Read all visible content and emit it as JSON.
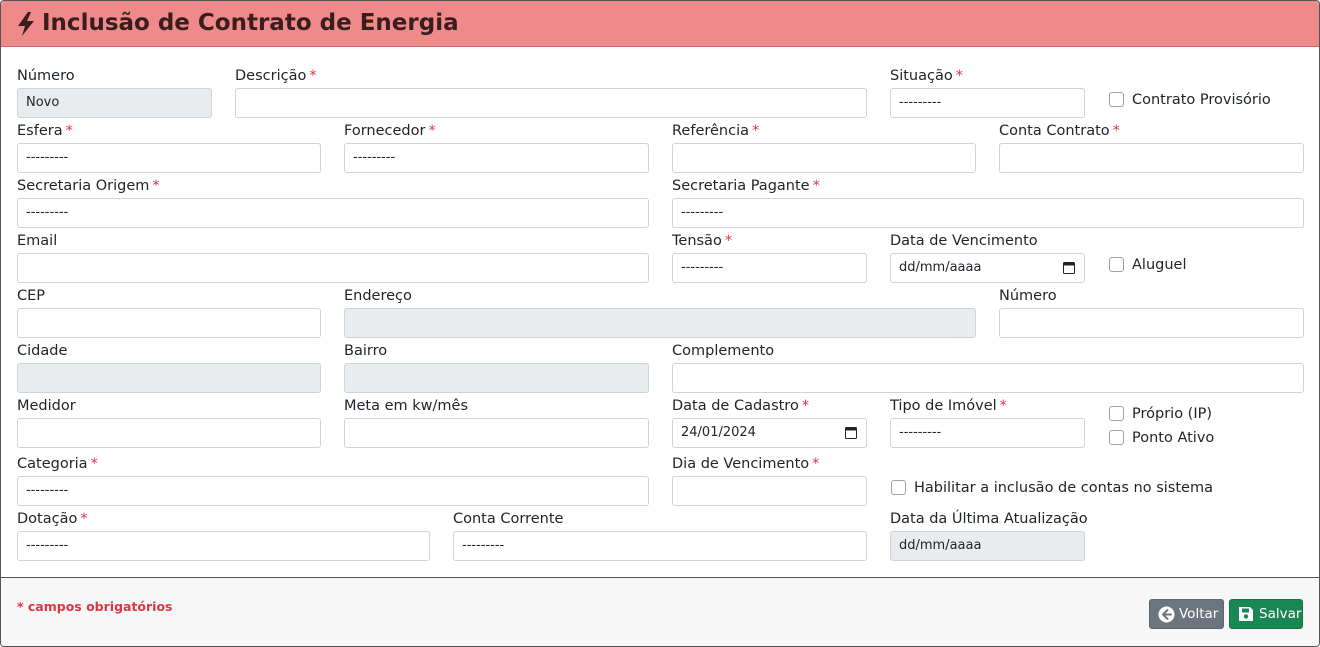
{
  "header": {
    "title": "Inclusão de Contrato de Energia"
  },
  "fields": {
    "numero": {
      "label": "Número",
      "value": "Novo"
    },
    "descricao": {
      "label": "Descrição",
      "value": ""
    },
    "situacao": {
      "label": "Situação",
      "value": "---------"
    },
    "contrato_provisorio": {
      "label": "Contrato Provisório",
      "checked": false
    },
    "esfera": {
      "label": "Esfera",
      "value": "---------"
    },
    "fornecedor": {
      "label": "Fornecedor",
      "value": "---------"
    },
    "referencia": {
      "label": "Referência",
      "value": ""
    },
    "conta_contrato": {
      "label": "Conta Contrato",
      "value": ""
    },
    "secretaria_origem": {
      "label": "Secretaria Origem",
      "value": "---------"
    },
    "secretaria_pagante": {
      "label": "Secretaria Pagante",
      "value": "---------"
    },
    "email": {
      "label": "Email",
      "value": ""
    },
    "tensao": {
      "label": "Tensão",
      "value": "---------"
    },
    "data_vencimento": {
      "label": "Data de Vencimento",
      "placeholder": "dd/mm/aaaa"
    },
    "aluguel": {
      "label": "Aluguel",
      "checked": false
    },
    "cep": {
      "label": "CEP",
      "value": ""
    },
    "endereco": {
      "label": "Endereço",
      "value": ""
    },
    "numero_endereco": {
      "label": "Número",
      "value": ""
    },
    "cidade": {
      "label": "Cidade",
      "value": ""
    },
    "bairro": {
      "label": "Bairro",
      "value": ""
    },
    "complemento": {
      "label": "Complemento",
      "value": ""
    },
    "medidor": {
      "label": "Medidor",
      "value": ""
    },
    "meta": {
      "label": "Meta em kw/mês",
      "value": ""
    },
    "data_cadastro": {
      "label": "Data de Cadastro",
      "value": "24/01/2024"
    },
    "tipo_imovel": {
      "label": "Tipo de Imóvel",
      "value": "---------"
    },
    "proprio_ip": {
      "label": "Próprio (IP)",
      "checked": false
    },
    "ponto_ativo": {
      "label": "Ponto Ativo",
      "checked": false
    },
    "categoria": {
      "label": "Categoria",
      "value": "---------"
    },
    "dia_vencimento": {
      "label": "Dia de Vencimento",
      "value": ""
    },
    "habilitar_contas": {
      "label": "Habilitar a inclusão de contas no sistema",
      "checked": false
    },
    "dotacao": {
      "label": "Dotação",
      "value": "---------"
    },
    "conta_corrente": {
      "label": "Conta Corrente",
      "value": "---------"
    },
    "data_ultima_atualizacao": {
      "label": "Data da Última Atualização",
      "placeholder": "dd/mm/aaaa"
    }
  },
  "required_marker": "*",
  "footer": {
    "required_note": "* campos obrigatórios",
    "back_label": "Voltar",
    "save_label": "Salvar"
  },
  "colors": {
    "header_bg": "#ef8a8a",
    "required": "#dc3545",
    "back_button": "#6c757d",
    "save_button": "#198754",
    "disabled_input": "#e9ecef"
  },
  "icons": {
    "title": "bolt-icon",
    "back": "arrow-left-circle-icon",
    "save": "floppy-disk-icon",
    "date": "calendar-icon"
  }
}
